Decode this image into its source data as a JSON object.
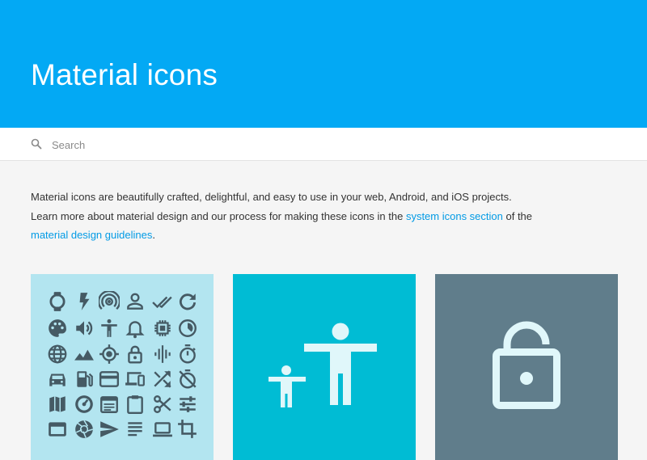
{
  "hero": {
    "title": "Material icons"
  },
  "search": {
    "placeholder": "Search"
  },
  "intro": {
    "line1": "Material icons are beautifully crafted, delightful, and easy to use in your web, Android, and iOS projects.",
    "line2_before": "Learn more about material design and our process for making these icons in the ",
    "link1": "system icons section",
    "line2_after": " of the",
    "link2": "material design guidelines",
    "end": "."
  },
  "cards": [
    {
      "name": "system-icons-card",
      "color": "#b3e5f0",
      "icon_color": "#455a64"
    },
    {
      "name": "accessibility-card",
      "color": "#00bcd4",
      "icon_color": "#e0f7fa"
    },
    {
      "name": "lock-open-card",
      "color": "#607d8b",
      "icon_color": "#e0f7fa"
    }
  ],
  "icon_grid": [
    [
      "watch-icon",
      "flash-icon",
      "wifi-tethering-icon",
      "person-outline-icon",
      "done-all-icon",
      "refresh-icon"
    ],
    [
      "palette-icon",
      "volume-up-icon",
      "accessibility-icon",
      "notifications-none-icon",
      "memory-icon",
      "timelapse-icon"
    ],
    [
      "language-icon",
      "terrain-icon",
      "gps-fixed-icon",
      "lock-outline-icon",
      "graphic-eq-icon",
      "timer-icon"
    ],
    [
      "directions-car-icon",
      "local-gas-station-icon",
      "credit-card-icon",
      "devices-icon",
      "shuffle-icon",
      "timer-off-icon"
    ],
    [
      "map-icon",
      "speed-icon",
      "event-note-icon",
      "assignment-icon",
      "content-cut-icon",
      "tune-icon"
    ],
    [
      "web-asset-icon",
      "camera-icon",
      "send-icon",
      "subject-icon",
      "laptop-icon",
      "crop-icon"
    ]
  ]
}
